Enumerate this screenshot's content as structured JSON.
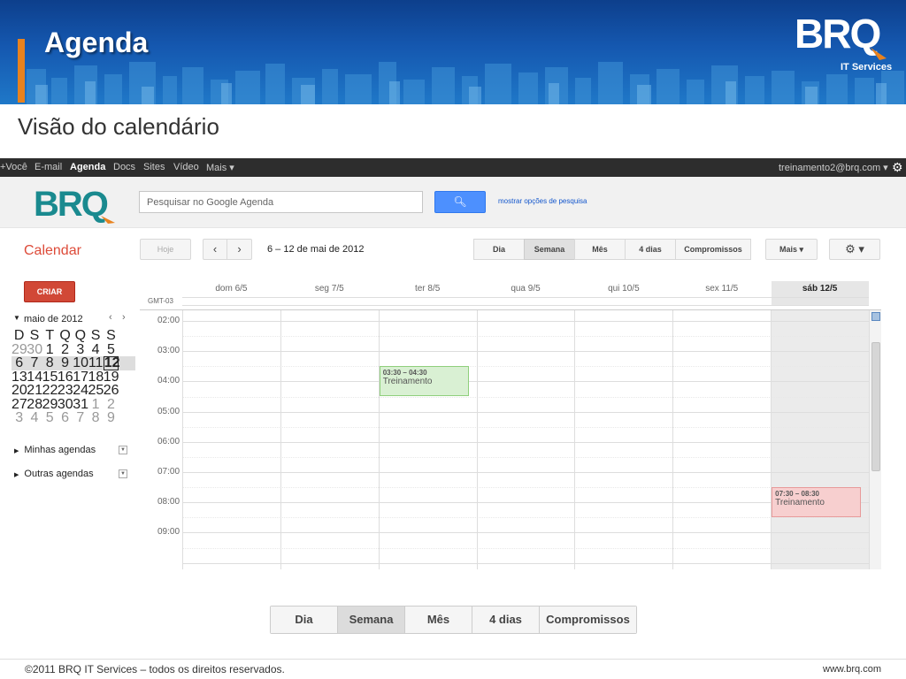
{
  "slide": {
    "title": "Agenda",
    "subtitle": "Visão do calendário",
    "logo_sub": "IT Services",
    "footer_left": "©2011 BRQ IT Services – todos os direitos reservados.",
    "footer_right": "www.brq.com",
    "accent": "#e8821e",
    "banner_color": "#1558b0"
  },
  "gbar": {
    "links": [
      "+Você",
      "E-mail",
      "Agenda",
      "Docs",
      "Sites",
      "Vídeo",
      "Mais ▾"
    ],
    "active": "Agenda",
    "account": "treinamento2@brq.com ▾"
  },
  "search": {
    "placeholder": "Pesquisar no Google Agenda",
    "options_link": "mostrar opções de pesquisa"
  },
  "toolbar": {
    "app_label": "Calendar",
    "today": "Hoje",
    "date_range": "6 – 12 de mai de 2012",
    "views": [
      "Dia",
      "Semana",
      "Mês",
      "4 dias",
      "Compromissos"
    ],
    "selected_view": "Semana",
    "more": "Mais ▾",
    "settings": "⚙ ▾"
  },
  "sidebar": {
    "create": "CRIAR",
    "mini_cal": {
      "title": "maio de 2012",
      "dow": [
        "D",
        "S",
        "T",
        "Q",
        "Q",
        "S",
        "S"
      ],
      "weeks": [
        [
          "29",
          "30",
          "1",
          "2",
          "3",
          "4",
          "5"
        ],
        [
          "6",
          "7",
          "8",
          "9",
          "10",
          "11",
          "12"
        ],
        [
          "13",
          "14",
          "15",
          "16",
          "17",
          "18",
          "19"
        ],
        [
          "20",
          "21",
          "22",
          "23",
          "24",
          "25",
          "26"
        ],
        [
          "27",
          "28",
          "29",
          "30",
          "31",
          "1",
          "2"
        ],
        [
          "3",
          "4",
          "5",
          "6",
          "7",
          "8",
          "9"
        ]
      ],
      "today": "12"
    },
    "my_calendars": "Minhas agendas",
    "other_calendars": "Outras agendas"
  },
  "grid": {
    "timezone": "GMT-03",
    "days": [
      "dom 6/5",
      "seg 7/5",
      "ter 8/5",
      "qua 9/5",
      "qui 10/5",
      "sex 11/5",
      "sáb 12/5"
    ],
    "hours": [
      "02:00",
      "03:00",
      "04:00",
      "05:00",
      "06:00",
      "07:00",
      "08:00",
      "09:00"
    ],
    "events": [
      {
        "time": "03:30 – 04:30",
        "name": "Treinamento",
        "day": "ter 8/5",
        "color": "#d9f0d3",
        "border": "#8fcf7c"
      },
      {
        "time": "07:30 – 08:30",
        "name": "Treinamento",
        "day": "sáb 12/5",
        "color": "#f7cfcf",
        "border": "#e79a9a"
      }
    ]
  },
  "bottom_views": {
    "items": [
      "Dia",
      "Semana",
      "Mês",
      "4 dias",
      "Compromissos"
    ],
    "selected": "Semana"
  }
}
